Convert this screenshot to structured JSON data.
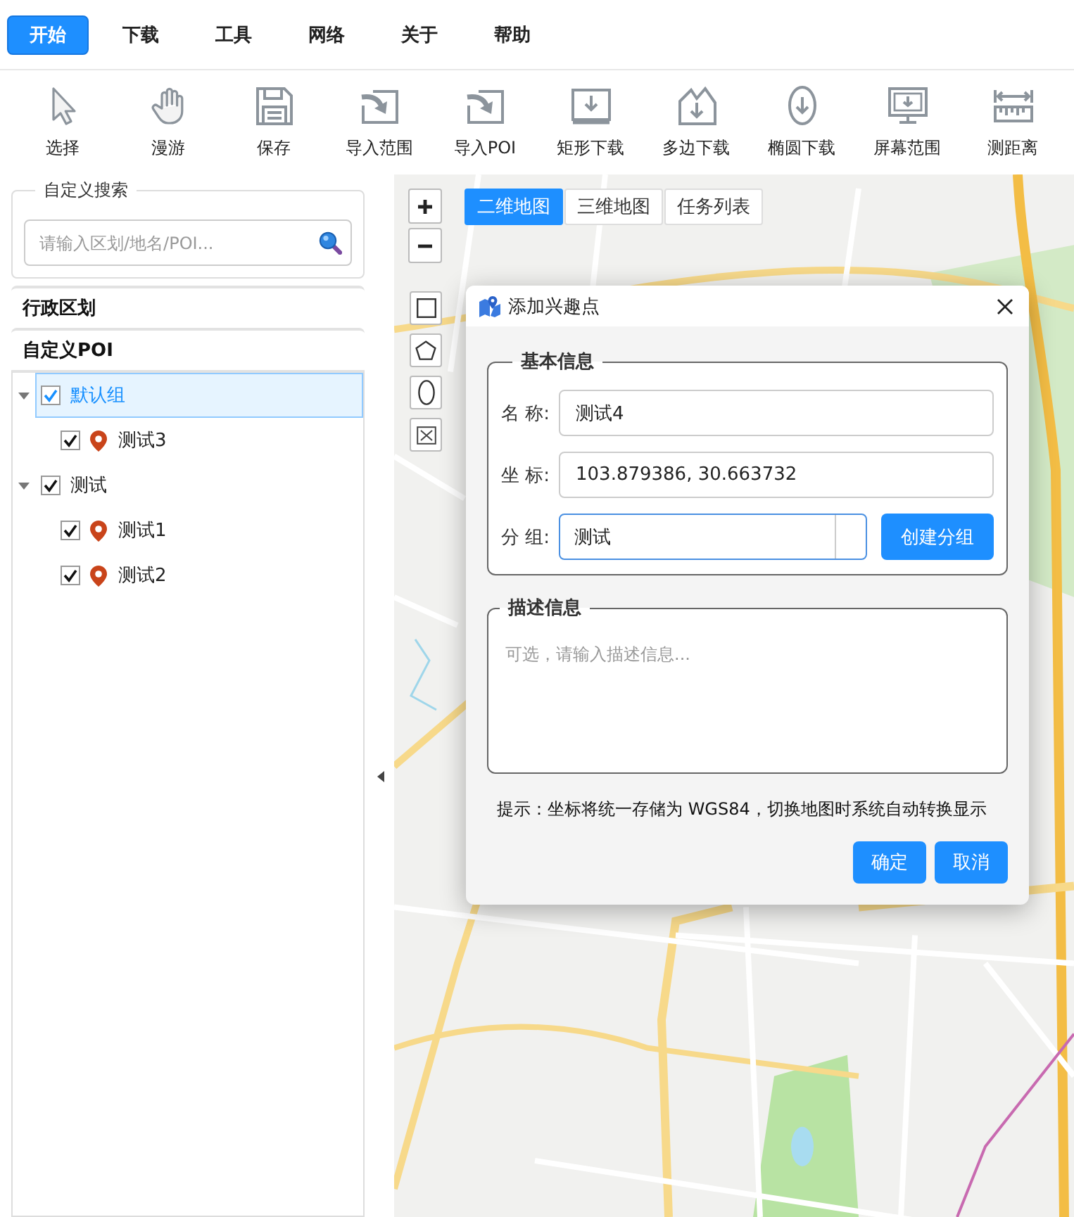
{
  "menu_tabs": [
    {
      "label": "开始",
      "selected": true
    },
    {
      "label": "下载",
      "selected": false
    },
    {
      "label": "工具",
      "selected": false
    },
    {
      "label": "网络",
      "selected": false
    },
    {
      "label": "关于",
      "selected": false
    },
    {
      "label": "帮助",
      "selected": false
    }
  ],
  "toolbar": [
    {
      "label": "选择"
    },
    {
      "label": "漫游"
    },
    {
      "label": "保存"
    },
    {
      "label": "导入范围"
    },
    {
      "label": "导入POI"
    },
    {
      "label": "矩形下载"
    },
    {
      "label": "多边下载"
    },
    {
      "label": "椭圆下载"
    },
    {
      "label": "屏幕范围"
    },
    {
      "label": "测距离"
    }
  ],
  "sidebar": {
    "search": {
      "legend": "自定义搜索",
      "placeholder": "请输入区划/地名/POI..."
    },
    "sections": [
      {
        "title": "行政区划"
      },
      {
        "title": "自定义POI",
        "tree": [
          {
            "kind": "group",
            "label": "默认组",
            "selected": true,
            "expanded": true,
            "checked": true,
            "children": [
              {
                "kind": "poi",
                "label": "测试3",
                "selected": false,
                "checked": true
              }
            ]
          },
          {
            "kind": "group",
            "label": "测试",
            "selected": false,
            "expanded": true,
            "checked": true,
            "children": [
              {
                "kind": "poi",
                "label": "测试1",
                "selected": false,
                "checked": true
              },
              {
                "kind": "poi",
                "label": "测试2",
                "selected": false,
                "checked": true
              }
            ]
          }
        ]
      }
    ]
  },
  "map": {
    "view_tabs": [
      {
        "label": "二维地图",
        "selected": true
      },
      {
        "label": "三维地图",
        "selected": false
      },
      {
        "label": "任务列表",
        "selected": false
      }
    ]
  },
  "dialog": {
    "title": "添加兴趣点",
    "basic_info": {
      "legend": "基本信息",
      "fields": [
        {
          "kind": "text",
          "label": "名 称:",
          "value": "测试4",
          "focused": false
        },
        {
          "kind": "text",
          "label": "坐 标:",
          "value": "103.879386, 30.663732",
          "focused": false
        },
        {
          "kind": "select",
          "label": "分 组:",
          "value": "测试",
          "focused": true
        }
      ],
      "create_group_button": "创建分组"
    },
    "description": {
      "legend": "描述信息",
      "placeholder": "可选，请输入描述信息..."
    },
    "hint": "提示：坐标将统一存储为 WGS84，切换地图时系统自动转换显示",
    "buttons": [
      {
        "label": "确定"
      },
      {
        "label": "取消"
      }
    ]
  }
}
